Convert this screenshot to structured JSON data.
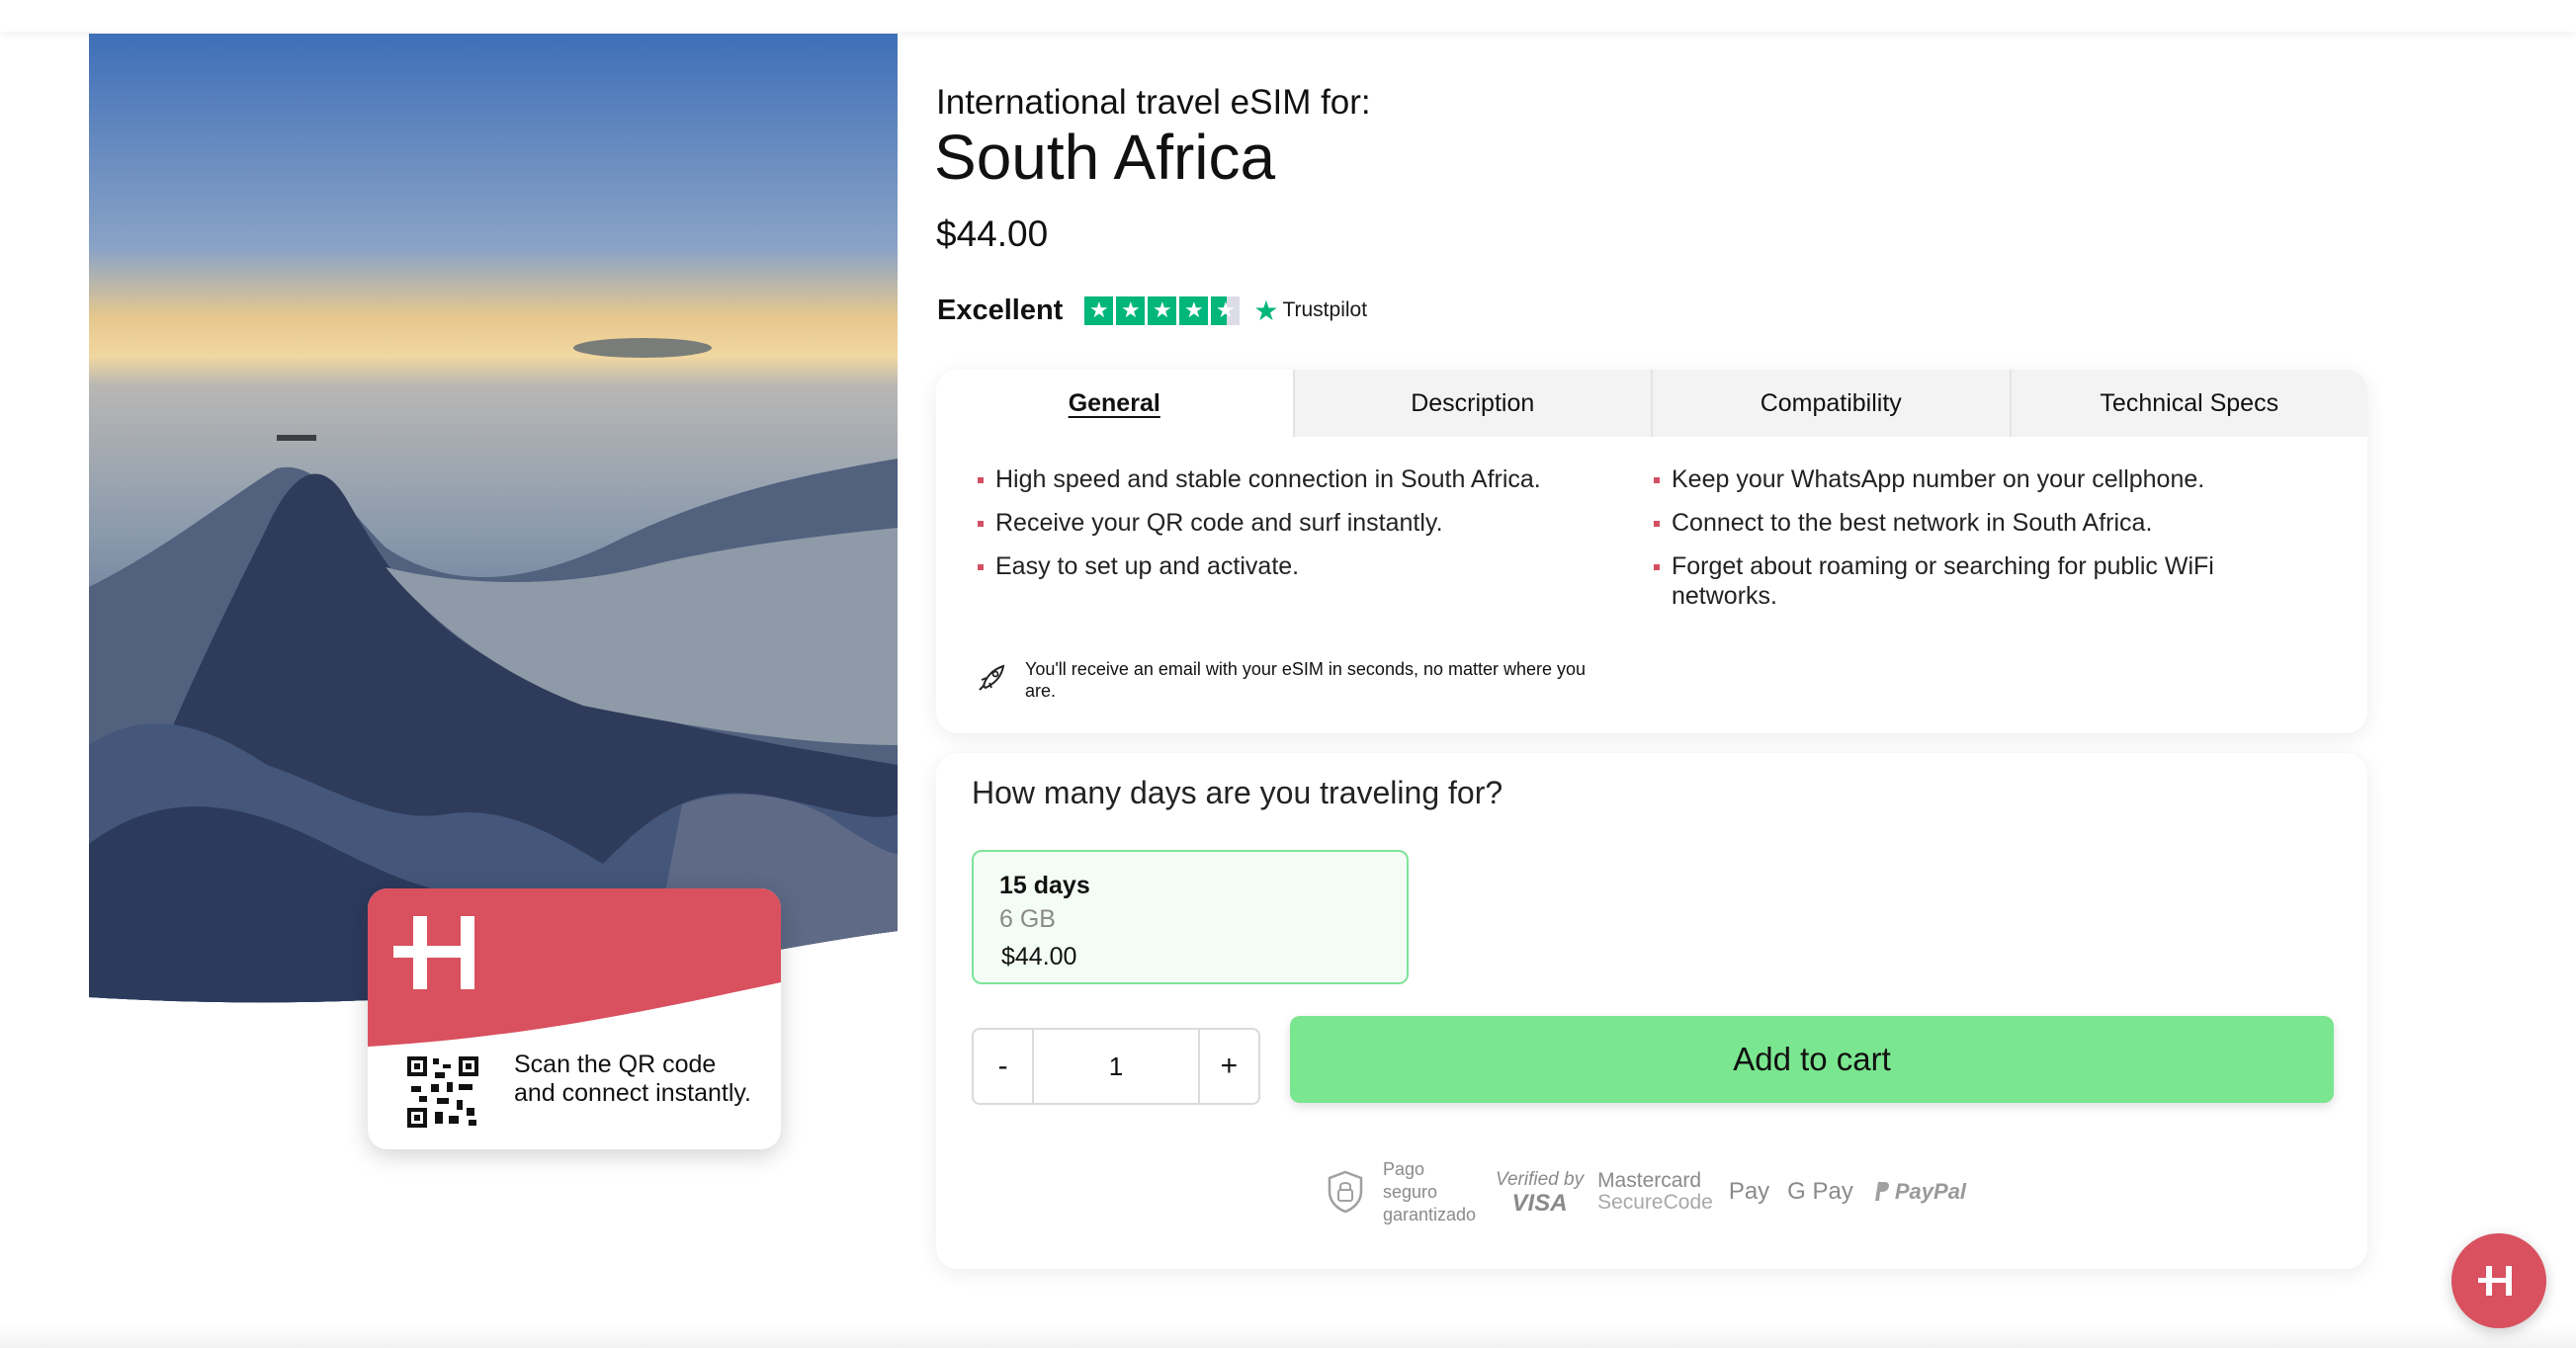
{
  "hero": {
    "image_description_icon": "mountain-photo",
    "qr_card_text": "Scan the QR code and connect instantly.",
    "brand_color": "#d9505e"
  },
  "product": {
    "subtitle": "International travel eSIM for:",
    "title": "South Africa",
    "price": "$44.00"
  },
  "rating": {
    "label": "Excellent",
    "stars": 4.5,
    "provider": "Trustpilot"
  },
  "tabs": [
    {
      "label": "General",
      "active": true
    },
    {
      "label": "Description",
      "active": false
    },
    {
      "label": "Compatibility",
      "active": false
    },
    {
      "label": "Technical Specs",
      "active": false
    }
  ],
  "features_left": [
    "High speed and stable connection in South Africa.",
    "Receive your QR code and surf instantly.",
    "Easy to set up and activate."
  ],
  "features_right": [
    "Keep your WhatsApp number on your cellphone.",
    "Connect to the best network in South Africa.",
    "Forget about roaming or searching for public WiFi networks."
  ],
  "email_note": "You'll receive an email with your eSIM in seconds, no matter where you are.",
  "purchase": {
    "question": "How many days are you traveling for?",
    "plan": {
      "days": "15 days",
      "data": "6 GB",
      "price": "$44.00"
    },
    "quantity": "1",
    "minus_label": "-",
    "plus_label": "+",
    "add_to_cart": "Add to cart"
  },
  "payments": {
    "secure_text": "Pago seguro garantizado",
    "visa_top": "Verified by",
    "visa_bottom": "VISA",
    "mastercard_top": "Mastercard",
    "mastercard_bottom": "SecureCode",
    "apple_pay": "Pay",
    "google_pay": "G Pay",
    "paypal": "PayPal"
  },
  "colors": {
    "accent_green": "#7ae68f",
    "trustpilot_green": "#00b67a",
    "bullet_red": "#d34f62",
    "brand_red": "#d9505e"
  }
}
